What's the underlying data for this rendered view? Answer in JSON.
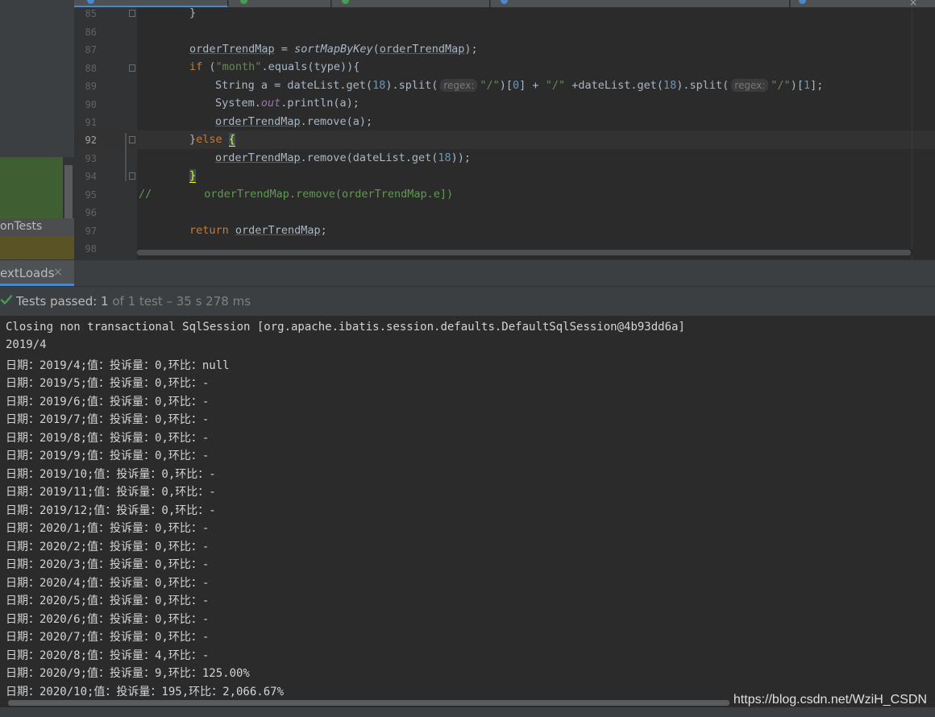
{
  "tabs": [
    {
      "color": "#4a88c7"
    },
    {
      "color": "#499c54"
    },
    {
      "color": "#499c54"
    },
    {
      "color": "#4a88c7"
    },
    {
      "color": "#4a88c7"
    }
  ],
  "tab_close_glyph": "×",
  "project_panel": {
    "selected_item": "onTests"
  },
  "editor": {
    "line_numbers": [
      "85",
      "86",
      "87",
      "88",
      "89",
      "90",
      "91",
      "92",
      "93",
      "94",
      "95",
      "96",
      "97",
      "98"
    ],
    "current_line": "92",
    "hint_regex": "regex:"
  },
  "run_window": {
    "tab_label": "extLoads",
    "tab_close": "×",
    "status": {
      "prefix": "Tests passed: ",
      "passed": "1",
      "rest": " of 1 test – 35 s 278 ms"
    }
  },
  "console": {
    "lines": [
      "Closing non transactional SqlSession [org.apache.ibatis.session.defaults.DefaultSqlSession@4b93dd6a]",
      "2019/4",
      "日期：2019/4;值：投诉量：0,环比：null",
      "日期：2019/5;值：投诉量：0,环比：-",
      "日期：2019/6;值：投诉量：0,环比：-",
      "日期：2019/7;值：投诉量：0,环比：-",
      "日期：2019/8;值：投诉量：0,环比：-",
      "日期：2019/9;值：投诉量：0,环比：-",
      "日期：2019/10;值：投诉量：0,环比：-",
      "日期：2019/11;值：投诉量：0,环比：-",
      "日期：2019/12;值：投诉量：0,环比：-",
      "日期：2020/1;值：投诉量：0,环比：-",
      "日期：2020/2;值：投诉量：0,环比：-",
      "日期：2020/3;值：投诉量：0,环比：-",
      "日期：2020/4;值：投诉量：0,环比：-",
      "日期：2020/5;值：投诉量：0,环比：-",
      "日期：2020/6;值：投诉量：0,环比：-",
      "日期：2020/7;值：投诉量：0,环比：-",
      "日期：2020/8;值：投诉量：4,环比：-",
      "日期：2020/9;值：投诉量：9,环比：125.00%",
      "日期：2020/10;值：投诉量：195,环比：2,066.67%"
    ]
  },
  "watermark": "https://blog.csdn.net/WziH_CSDN",
  "colors": {
    "keyword": "#cc7832",
    "string": "#6a8759",
    "number": "#6897bb",
    "comment": "#629755",
    "test_passed_check": "#499c54"
  },
  "icons": [
    "check-icon",
    "close-icon",
    "fold-marker-icon"
  ]
}
